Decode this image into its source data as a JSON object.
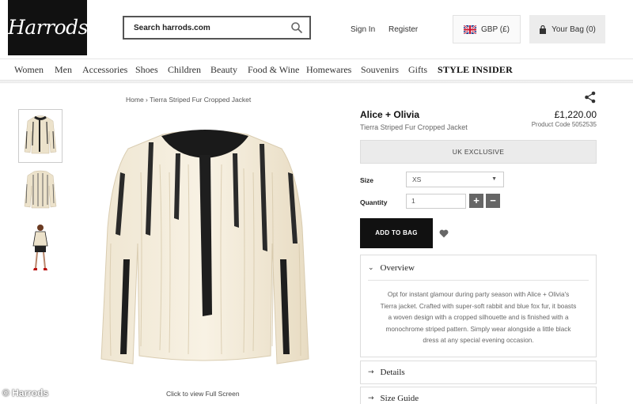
{
  "header": {
    "logo": "Harrods",
    "search_placeholder": "Search harrods.com",
    "sign_in": "Sign In",
    "register": "Register",
    "currency": "GBP (£)",
    "bag": "Your Bag (0)"
  },
  "nav": {
    "items": [
      "Women",
      "Men",
      "Accessories",
      "Shoes",
      "Children",
      "Beauty",
      "Food & Wine",
      "Homewares",
      "Souvenirs",
      "Gifts"
    ],
    "highlight": "STYLE INSIDER"
  },
  "breadcrumb": "Home › Tierra Striped Fur Cropped Jacket",
  "product": {
    "brand": "Alice + Olivia",
    "name": "Tierra Striped Fur Cropped Jacket",
    "price": "£1,220.00",
    "code": "Product Code 5052535",
    "exclusive": "UK EXCLUSIVE",
    "size_label": "Size",
    "size_value": "XS",
    "quantity_label": "Quantity",
    "quantity_value": "1",
    "qty_plus": "+",
    "qty_minus": "−",
    "add_to_bag": "ADD TO BAG"
  },
  "main_image": {
    "caption": "Click to view Full Screen"
  },
  "accordion": {
    "overview_title": "Overview",
    "overview_text": "Opt for instant glamour during party season with Alice + Olivia's Tierra jacket. Crafted with super-soft rabbit and blue fox fur, it boasts a woven design with a cropped silhouette and is finished with a monochrome striped pattern. Simply wear alongside a little black dress at any special evening occasion.",
    "details_title": "Details",
    "size_guide_title": "Size Guide"
  },
  "watermark": "© Harrods",
  "icons": {
    "search": "search-icon",
    "flag": "uk-flag-icon",
    "bag": "bag-icon",
    "share": "share-icon",
    "heart": "heart-icon"
  },
  "colors": {
    "brand_black": "#111111",
    "button_gray": "#666666",
    "exclusive_bg": "#ebebeb"
  }
}
